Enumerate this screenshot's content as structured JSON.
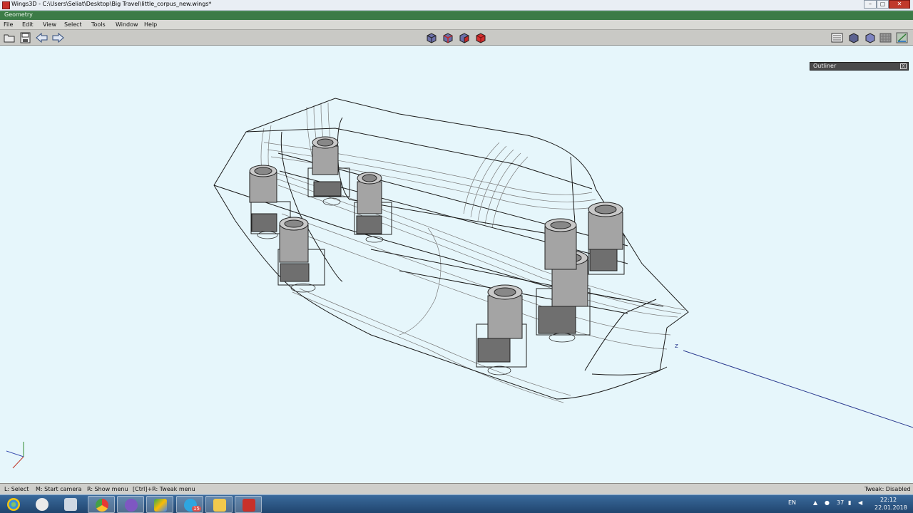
{
  "window": {
    "title": "Wings3D - C:\\Users\\Seliat\\Desktop\\Big Travel\\little_corpus_new.wings*",
    "minimize": "–",
    "maximize": "▢",
    "close": "✕"
  },
  "geometry_bar": {
    "label": "Geometry"
  },
  "menu": {
    "items": [
      "File",
      "Edit",
      "View",
      "Select",
      "Tools",
      "Window",
      "Help"
    ]
  },
  "toolbar": {
    "left_icons": [
      "open-folder-icon",
      "save-icon",
      "undo-arrow-icon",
      "redo-arrow-icon"
    ],
    "selection_modes": [
      "vertex-mode-icon",
      "edge-mode-icon",
      "face-mode-icon",
      "body-mode-icon"
    ],
    "right_icons": [
      "groundplane-icon",
      "wireframe-icon",
      "smooth-preview-icon",
      "grid-icon",
      "axes-icon"
    ]
  },
  "viewport": {
    "background": "#e6f6fb",
    "axis_label_z": "z"
  },
  "outliner": {
    "title": "Outliner",
    "close": "X"
  },
  "statusbar": {
    "hint_select": "L: Select",
    "hint_camera": "M: Start camera",
    "hint_menu": "R: Show menu",
    "hint_tweak_menu": "[Ctrl]+R: Tweak menu",
    "tweak_state": "Tweak: Disabled"
  },
  "taskbar": {
    "apps": [
      "start-orb-icon",
      "paint-icon",
      "calculator-icon",
      "chrome-icon",
      "tor-icon",
      "google-drive-icon",
      "telegram-icon",
      "file-explorer-icon",
      "wings3d-icon"
    ],
    "telegram_badge": "15",
    "tray": {
      "language": "EN",
      "temperature": "37",
      "time": "22:12",
      "date": "22.01.2018"
    }
  },
  "colors": {
    "title_bar": "#e9eef4",
    "geometry_bar": "#3c7b47",
    "menu_bar": "#d9d9d5",
    "viewport_bg": "#e6f6fb",
    "taskbar": "#2b5585"
  }
}
